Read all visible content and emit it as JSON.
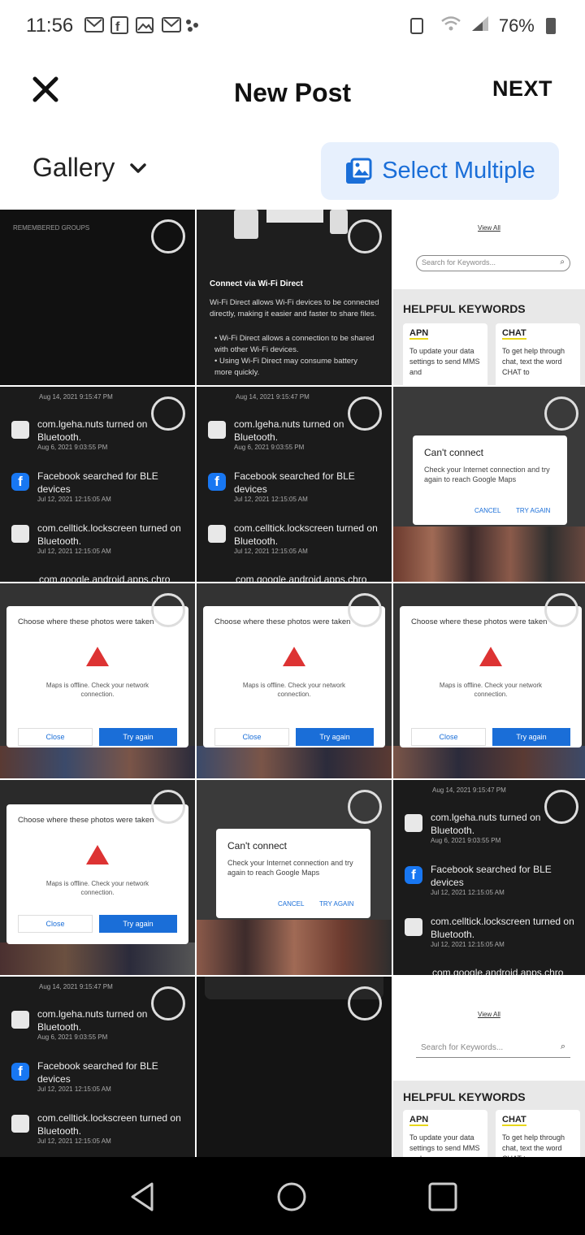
{
  "status": {
    "time": "11:56",
    "battery": "76%",
    "notif_icons": [
      "gmail-icon",
      "facebook-icon",
      "gallery-icon",
      "gmail-icon",
      "dots-icon"
    ]
  },
  "header": {
    "title": "New Post",
    "next_label": "NEXT"
  },
  "album": {
    "selected": "Gallery",
    "select_multiple_label": "Select Multiple"
  },
  "thumbnails": {
    "remembered_groups": "REMEMBERED GROUPS",
    "wifi_direct_title": "Connect via Wi-Fi Direct",
    "wifi_direct_body": "Wi-Fi Direct allows Wi-Fi devices to be connected directly, making it easier and faster to share files.",
    "wifi_direct_bullet1": "• Wi-Fi Direct allows a connection to be shared with other Wi-Fi devices.",
    "wifi_direct_bullet2": "• Using Wi-Fi Direct may consume battery more quickly.",
    "view_all": "View All",
    "search_placeholder": "Search for Keywords...",
    "helpful_keywords": "HELPFUL KEYWORDS",
    "apn_title": "APN",
    "apn_body": "To update your data settings to send MMS and",
    "chat_title": "CHAT",
    "chat_body": "To get help through chat, text the word CHAT to",
    "notif1_title": "com.lgeha.nuts turned on Bluetooth.",
    "notif1_time": "Aug 6, 2021 9:03:55 PM",
    "notif2_title": "Facebook searched for BLE devices",
    "notif2_time": "Jul 12, 2021 12:15:05 AM",
    "notif3_title": "com.celltick.lockscreen turned on Bluetooth.",
    "notif3_time": "Jul 12, 2021 12:15:05 AM",
    "notif_top_time": "Aug 14, 2021 9:15:47 PM",
    "notif_bottom_cut": "com.google.android.apps.chro",
    "cant_connect_title": "Can't connect",
    "cant_connect_body": "Check your Internet connection and try again to reach Google Maps",
    "cancel": "CANCEL",
    "try_again_caps": "TRY AGAIN",
    "choose_where_title": "Choose where these photos were taken",
    "maps_offline": "Maps is offline. Check your network connection.",
    "close": "Close",
    "try_again": "Try again"
  },
  "nav": {
    "back": "back-icon",
    "home": "home-icon",
    "recents": "recents-icon"
  }
}
